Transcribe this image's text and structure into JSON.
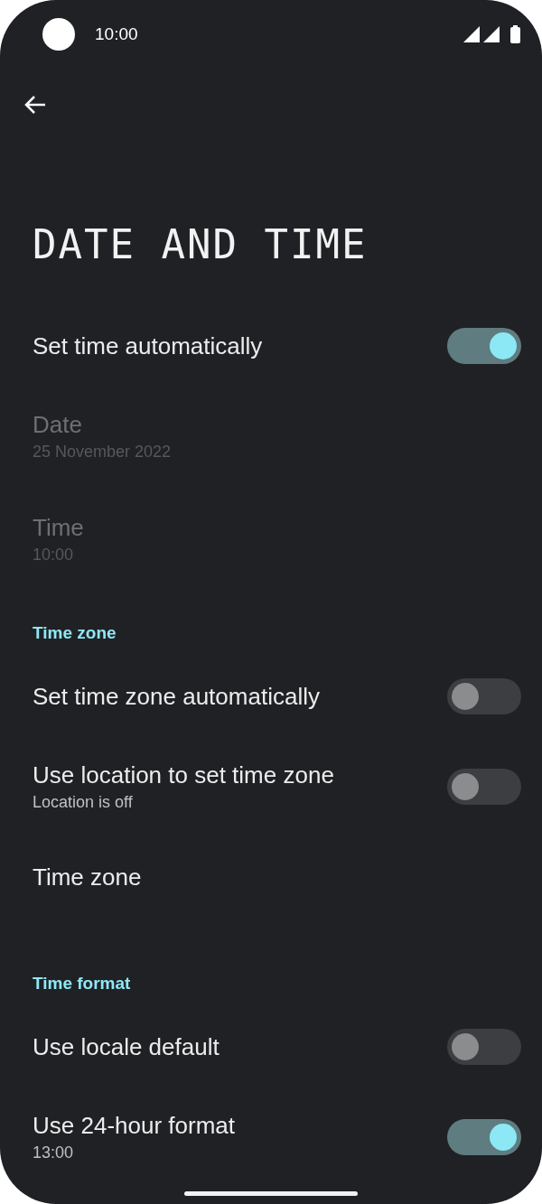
{
  "status_bar": {
    "time": "10:00"
  },
  "title": "DATE AND TIME",
  "groups": [
    {
      "items": [
        {
          "kind": "toggle",
          "title": "Set time automatically",
          "on": true,
          "disabled": false
        },
        {
          "kind": "plain",
          "title": "Date",
          "subtitle": "25 November 2022",
          "disabled": true
        },
        {
          "kind": "plain",
          "title": "Time",
          "subtitle": "10:00",
          "disabled": true
        }
      ]
    },
    {
      "header": "Time zone",
      "items": [
        {
          "kind": "toggle",
          "title": "Set time zone automatically",
          "on": false,
          "disabled": false
        },
        {
          "kind": "toggle",
          "title": "Use location to set time zone",
          "subtitle": "Location is off",
          "on": false,
          "disabled": false
        },
        {
          "kind": "plain",
          "title": "Time zone",
          "disabled": false
        }
      ]
    },
    {
      "header": "Time format",
      "items": [
        {
          "kind": "toggle",
          "title": "Use locale default",
          "on": false,
          "disabled": false
        },
        {
          "kind": "toggle",
          "title": "Use 24-hour format",
          "subtitle": "13:00",
          "on": true,
          "disabled": false
        }
      ]
    }
  ]
}
